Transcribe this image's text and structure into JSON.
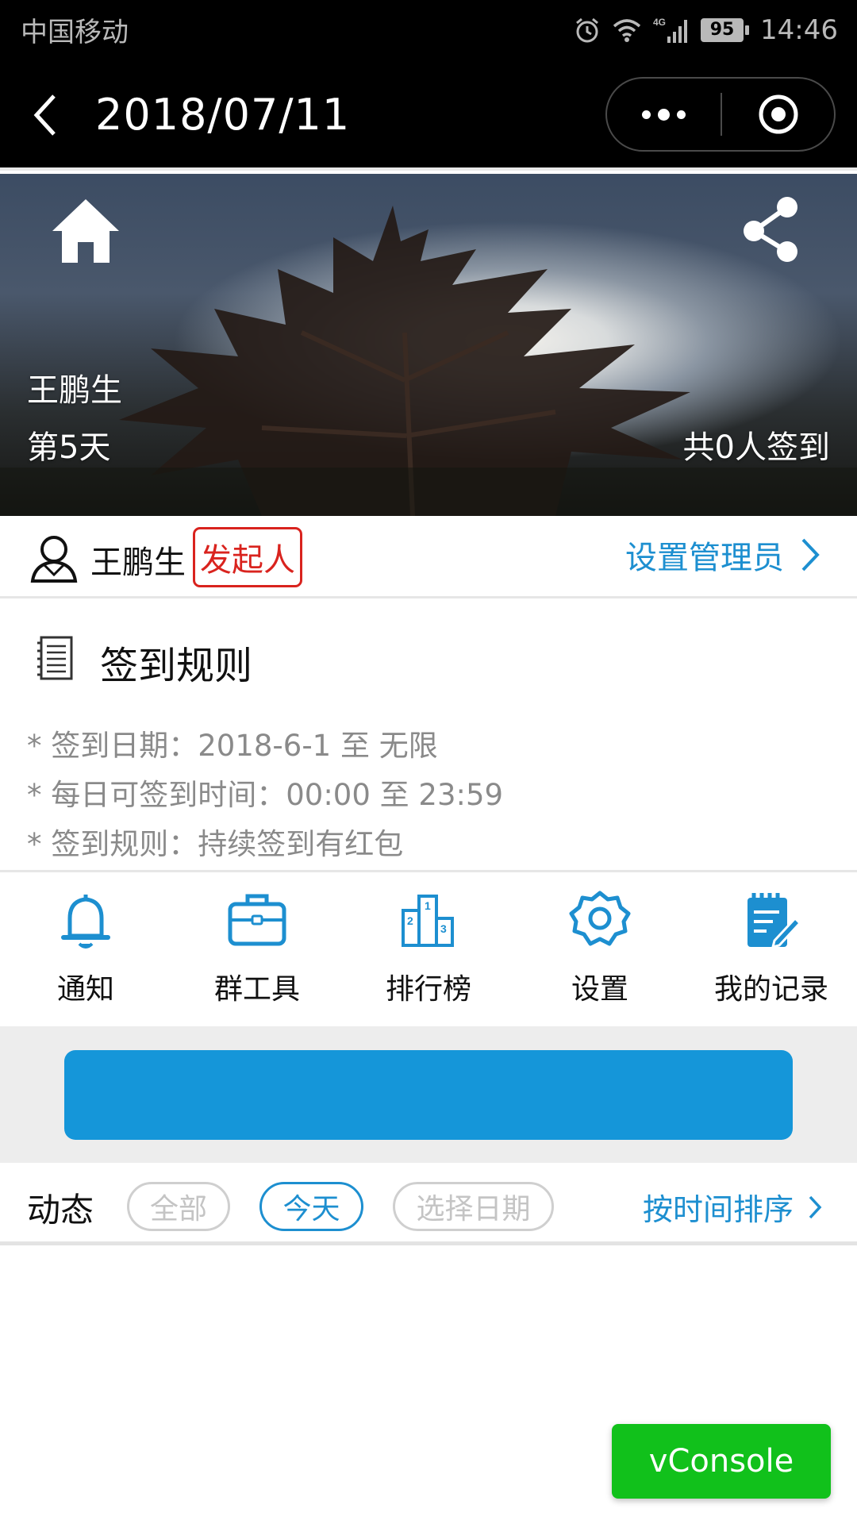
{
  "status_bar": {
    "carrier": "中国移动",
    "network": "4G",
    "battery": "95",
    "time": "14:46"
  },
  "nav": {
    "title": "2018/07/11",
    "icons": [
      "back-chevron-icon",
      "more-dots-icon",
      "close-target-icon"
    ]
  },
  "banner": {
    "name": "王鹏生",
    "day": "第5天",
    "signed_count": "共0人签到",
    "icons": [
      "home-icon",
      "share-icon"
    ]
  },
  "initiator": {
    "name": "王鹏生",
    "badge": "发起人",
    "admin_link": "设置管理员",
    "badge_color": "#d9231e",
    "link_color": "#1d8fd0"
  },
  "rules": {
    "title": "签到规则",
    "lines": [
      "* 签到日期：2018-6-1 至 无限",
      "* 每日可签到时间：00:00 至 23:59",
      "* 签到规则：持续签到有红包"
    ]
  },
  "toolbar": {
    "items": [
      {
        "label": "通知",
        "icon": "bell-icon"
      },
      {
        "label": "群工具",
        "icon": "briefcase-icon"
      },
      {
        "label": "排行榜",
        "icon": "podium-icon"
      },
      {
        "label": "设置",
        "icon": "gear-icon"
      },
      {
        "label": "我的记录",
        "icon": "notepad-icon"
      }
    ],
    "icon_color": "#1d8fd0"
  },
  "action": {
    "button_color": "#1596d9"
  },
  "feed": {
    "title": "动态",
    "chips": [
      {
        "label": "全部",
        "active": false
      },
      {
        "label": "今天",
        "active": true
      },
      {
        "label": "选择日期",
        "active": false
      }
    ],
    "sort_label": "按时间排序"
  },
  "vconsole": {
    "label": "vConsole",
    "color": "#11c11b"
  }
}
